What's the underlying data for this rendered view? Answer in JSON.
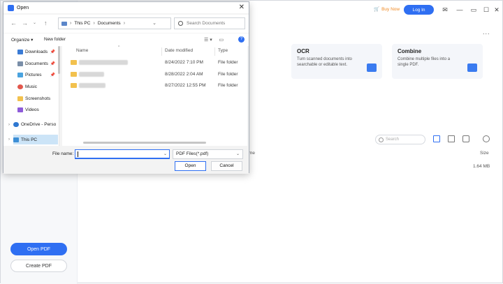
{
  "app": {
    "buy_now": "Buy Now",
    "login": "Log In",
    "more": "...",
    "open_pdf": "Open PDF",
    "create_pdf": "Create PDF",
    "accent": "#2f6ff2",
    "cards": [
      {
        "title": "OCR",
        "desc": "Turn scanned documents into searchable or editable text."
      },
      {
        "title": "Combine",
        "desc": "Combine multiple files into a single PDF."
      }
    ],
    "search_placeholder": "Search",
    "col_name_partial": "me",
    "col_size": "Size",
    "size_value": "1.64 MB"
  },
  "dialog": {
    "title": "Open",
    "path": [
      "This PC",
      "Documents"
    ],
    "search_placeholder": "Search Documents",
    "organize": "Organize",
    "new_folder": "New folder",
    "nav": [
      {
        "label": "Downloads",
        "icon": "download-icon"
      },
      {
        "label": "Documents",
        "icon": "document-icon"
      },
      {
        "label": "Pictures",
        "icon": "picture-icon"
      },
      {
        "label": "Music",
        "icon": "music-icon"
      },
      {
        "label": "Screenshots",
        "icon": "folder-icon"
      },
      {
        "label": "Videos",
        "icon": "video-icon"
      },
      {
        "label": "OneDrive - Perso",
        "icon": "cloud-icon"
      },
      {
        "label": "This PC",
        "icon": "computer-icon"
      }
    ],
    "columns": {
      "name": "Name",
      "date": "Date modified",
      "type": "Type"
    },
    "files": [
      {
        "date": "8/24/2022 7:10 PM",
        "type": "File folder"
      },
      {
        "date": "8/28/2022 2:04 AM",
        "type": "File folder"
      },
      {
        "date": "8/27/2022 12:55 PM",
        "type": "File folder"
      }
    ],
    "file_name_label": "File name:",
    "file_name_value": "",
    "file_type": "PDF Files(*.pdf)",
    "open": "Open",
    "cancel": "Cancel"
  }
}
